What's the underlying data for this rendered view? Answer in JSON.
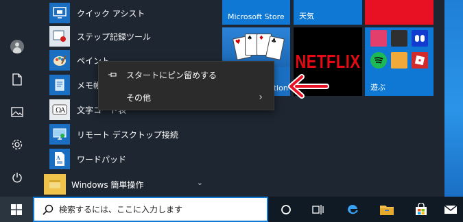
{
  "colors": {
    "accent": "#0f78d4",
    "store_tile": "#0f78d4",
    "red_tile": "#e81123",
    "netflix_red": "#e50914",
    "menu_bg": "#2b2b2b",
    "annotation": "#e81123"
  },
  "rail": {
    "icons": [
      "user-icon",
      "document-icon",
      "pictures-icon",
      "settings-gear-icon",
      "power-icon"
    ]
  },
  "apps": [
    {
      "label": "クイック アシスト",
      "icon": "quick-assist-icon"
    },
    {
      "label": "ステップ記録ツール",
      "icon": "steps-recorder-icon"
    },
    {
      "label": "ペイント",
      "icon": "paint-icon"
    },
    {
      "label": "メモ帳",
      "icon": "notepad-icon"
    },
    {
      "label": "文字コード表",
      "icon": "character-map-icon"
    },
    {
      "label": "リモート デスクトップ接続",
      "icon": "remote-desktop-icon"
    },
    {
      "label": "ワードパッド",
      "icon": "wordpad-icon"
    }
  ],
  "group": {
    "label": "Windows 簡単操作",
    "icon": "folder-icon",
    "chevron": "chevron-down-icon"
  },
  "tiles": {
    "store": "Microsoft Store",
    "weather": "天気",
    "solitaire_caption": "ation",
    "netflix": "NETFLIX",
    "play": "遊ぶ"
  },
  "context_menu": {
    "pin_label": "スタートにピン留めする",
    "more_label": "その他",
    "more_arrow": "›"
  },
  "taskbar": {
    "search_placeholder": "検索するには、ここに入力します",
    "icons": [
      "windows-start-icon",
      "search-icon",
      "cortana-icon",
      "task-view-icon",
      "edge-icon",
      "file-explorer-icon",
      "store-icon",
      "mail-icon"
    ]
  }
}
